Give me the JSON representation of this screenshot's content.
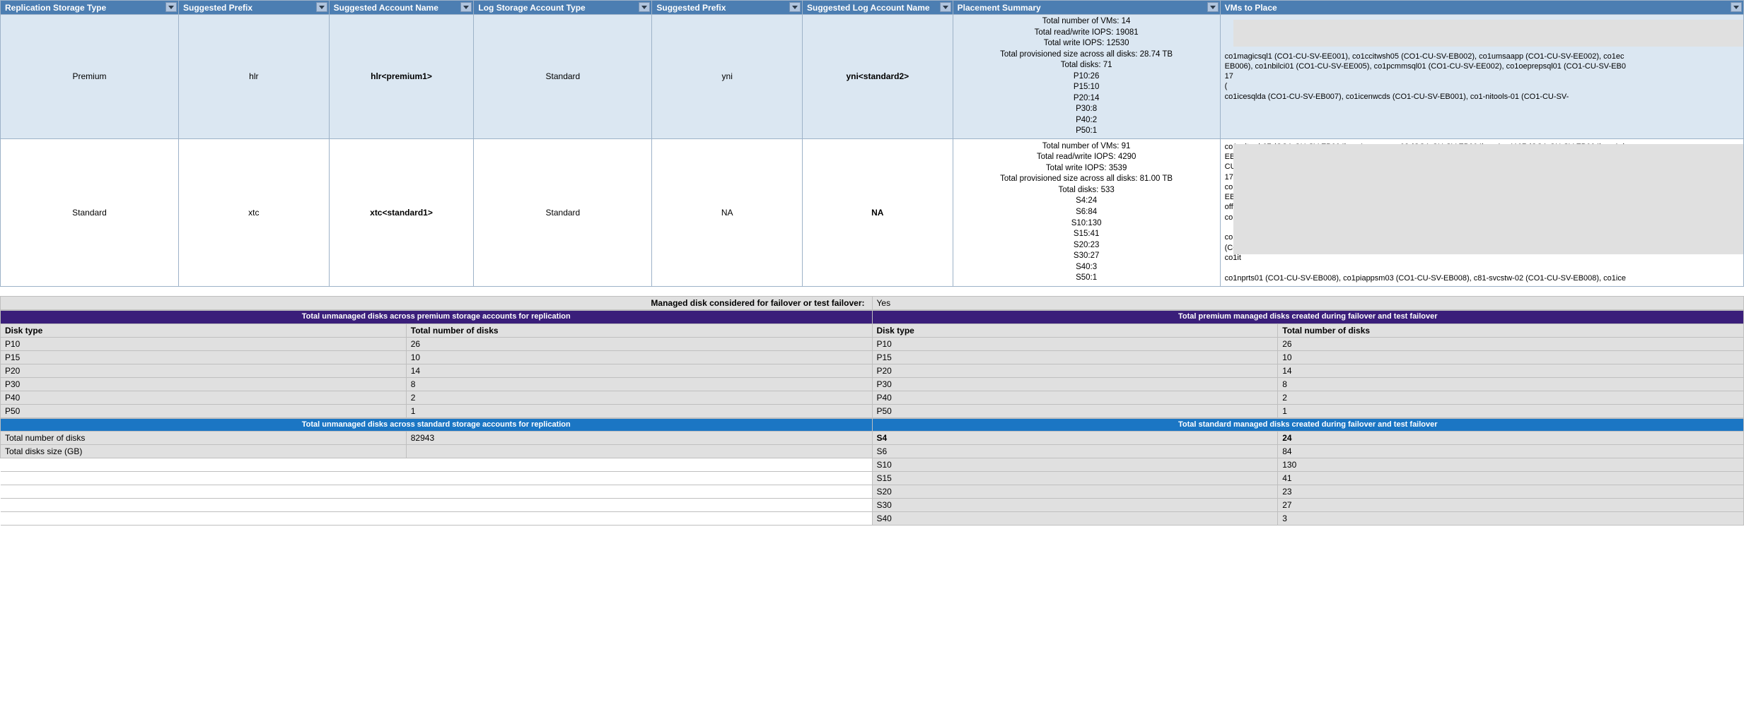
{
  "headers": {
    "a": "Replication Storage Type",
    "b": "Suggested Prefix",
    "c": "Suggested Account Name",
    "d": "Log Storage Account Type",
    "e": "Suggested Prefix",
    "f": "Suggested Log Account  Name",
    "g": "Placement Summary",
    "h": "VMs to Place"
  },
  "rows": [
    {
      "rep_type": "Premium",
      "prefix": "hlr",
      "account": "hlr<premium1>",
      "log_type": "Standard",
      "log_prefix": "yni",
      "log_account": "yni<standard2>",
      "summary": [
        "Total number of VMs: 14",
        "Total read/write IOPS: 19081",
        "Total write IOPS: 12530",
        "Total provisioned size across all disks: 28.74 TB",
        "Total disks: 71",
        "P10:26",
        "P15:10",
        "P20:14",
        "P30:8",
        "P40:2",
        "P50:1"
      ],
      "vms_lines": [
        "co1magicsql1 (CO1-CU-SV-EE001), co1ccitwsh05 (CO1-CU-SV-EB002), co1umsaapp (CO1-CU-SV-EE002), co1ec",
        "EB006), co1nbilci01 (CO1-CU-SV-EE005), co1pcmmsql01 (CO1-CU-SV-EE002), co1oeprepsql01 (CO1-CU-SV-EB0",
        "17",
        "(",
        "co1icesqlda (CO1-CU-SV-EB007), co1icenwcds (CO1-CU-SV-EB001), co1-nitools-01 (CO1-CU-SV-"
      ]
    },
    {
      "rep_type": "Standard",
      "prefix": "xtc",
      "account": "xtc<standard1>",
      "log_type": "Standard",
      "log_prefix": "NA",
      "log_account": "NA",
      "summary": [
        "Total number of VMs: 91",
        "Total read/write IOPS: 4290",
        "Total write IOPS: 3539",
        "Total provisioned size across all disks: 81.00 TB",
        "Total disks: 533",
        "S4:24",
        "S6:84",
        "S10:130",
        "S15:41",
        "S20:23",
        "S30:27",
        "S40:3",
        "S50:1"
      ],
      "vms_lines": [
        "co1ccitwsh07 (CO1-CU-SV-EB004), co1appnpnsm02 (CO1-CU-SV-EB004), co1cu1107 (CO1-CU-SV-EB004), co1xi",
        "EB004), co1pcmmsql01 (CO1-CU-SV-EE002), co1oeprepsql01 (CO1-CU-SV-EB008), co1icesqlda (CO1-CU-SV-EB0",
        "CU-SV-EB001), co1-nitools-01 (CO1-CU-SV-EB001), co1xirc01 (CO1-CU-SV-EB001), co1icesqlda (CO1-CU-S",
        "17 (CO1-CU-SV-EE002), co1pcmmsql01 (CO1-CU-SV-EE002), co1oeprepsql01 (CO1-CU-SV-EB008), co1ic (CO",
        "corp-co1-asa-01 (CO1-CU-SV-EB008), co1piappsm03 (CO1-CU-SV-EB008), co1",
        "EB004), co1pcmmsql01 (CO1-CU-SV-EE002), co1",
        "offl",
        "co1it",
        "",
        "co1",
        "(CO",
        "co1it",
        "",
        "co1nprts01 (CO1-CU-SV-EB008), co1piappsm03 (CO1-CU-SV-EB008), c81-svcstw-02 (CO1-CU-SV-EB008), co1ice"
      ]
    }
  ],
  "managed_label": "Managed disk considered for failover or test failover:",
  "managed_value": "Yes",
  "purple": {
    "left_title": "Total  unmanaged disks across premium storage accounts for replication",
    "right_title": "Total premium managed disks created during failover and test failover",
    "sub_a": "Disk type",
    "sub_b": "Total number of disks",
    "rows": [
      [
        "P10",
        "26",
        "P10",
        "26"
      ],
      [
        "P15",
        "10",
        "P15",
        "10"
      ],
      [
        "P20",
        "14",
        "P20",
        "14"
      ],
      [
        "P30",
        "8",
        "P30",
        "8"
      ],
      [
        "P40",
        "2",
        "P40",
        "2"
      ],
      [
        "P50",
        "1",
        "P50",
        "1"
      ]
    ]
  },
  "blue": {
    "left_title": "Total unmanaged disks across standard storage accounts for replication",
    "right_title": "Total standard managed disks created during failover and test failover",
    "left_rows": [
      [
        "Total number of disks",
        "82943"
      ],
      [
        "Total disks size (GB)",
        ""
      ]
    ],
    "right_rows": [
      [
        "S4",
        "24"
      ],
      [
        "S6",
        "84"
      ],
      [
        "S10",
        "130"
      ],
      [
        "S15",
        "41"
      ],
      [
        "S20",
        "23"
      ],
      [
        "S30",
        "27"
      ],
      [
        "S40",
        "3"
      ]
    ]
  }
}
